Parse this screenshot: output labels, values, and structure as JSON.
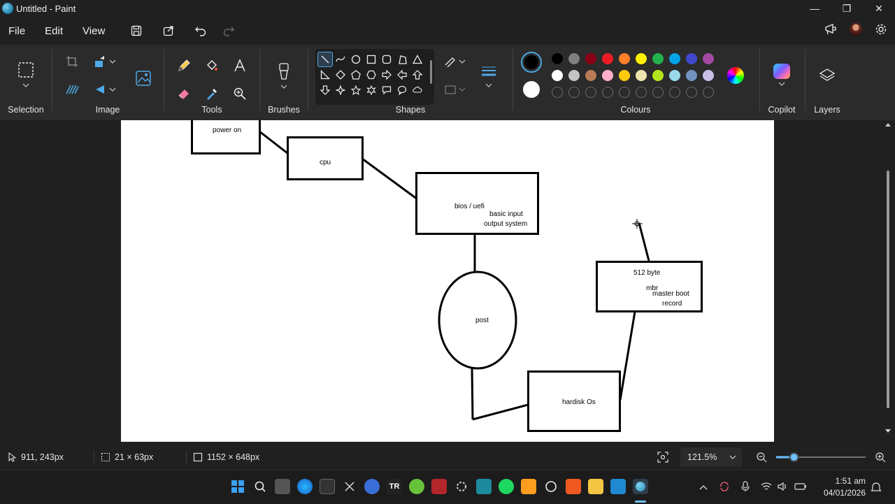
{
  "window": {
    "title": "Untitled - Paint",
    "minimize": "—",
    "maximize": "❐",
    "close": "✕"
  },
  "menu": {
    "file": "File",
    "edit": "Edit",
    "view": "View"
  },
  "ribbon": {
    "selection": "Selection",
    "image": "Image",
    "tools": "Tools",
    "brushes": "Brushes",
    "shapes": "Shapes",
    "colours": "Colours",
    "copilot": "Copilot",
    "layers": "Layers"
  },
  "palette": {
    "primary": "#000000",
    "secondary": "#ffffff",
    "row1": [
      "#000000",
      "#7f7f7f",
      "#880015",
      "#ed1c24",
      "#ff7f27",
      "#fff200",
      "#22b14c",
      "#00a2e8",
      "#3f48cc",
      "#a349a4"
    ],
    "row2": [
      "#ffffff",
      "#c3c3c3",
      "#b97a57",
      "#ffaec9",
      "#ffc90e",
      "#efe4b0",
      "#b5e61d",
      "#99d9ea",
      "#7092be",
      "#c8bfe7"
    ]
  },
  "diagram": {
    "power_on": "power on",
    "cpu": "cpu",
    "bios_title": "bios / uefi",
    "bios_desc_1": "basic input",
    "bios_desc_2": "output system",
    "post": "post",
    "mbr_size": "512 byte",
    "mbr": "mbr",
    "mbr_desc_1": "master boot",
    "mbr_desc_2": "record",
    "hardisk": "hardisk Os"
  },
  "status": {
    "cursor_pos": "911, 243px",
    "selection_size": "21 × 63px",
    "canvas_size": "1152 × 648px",
    "zoom": "121.5%",
    "zoom_level": 0.2
  },
  "taskbar": {
    "time": "1:51 am",
    "date": "04/01/2026"
  }
}
